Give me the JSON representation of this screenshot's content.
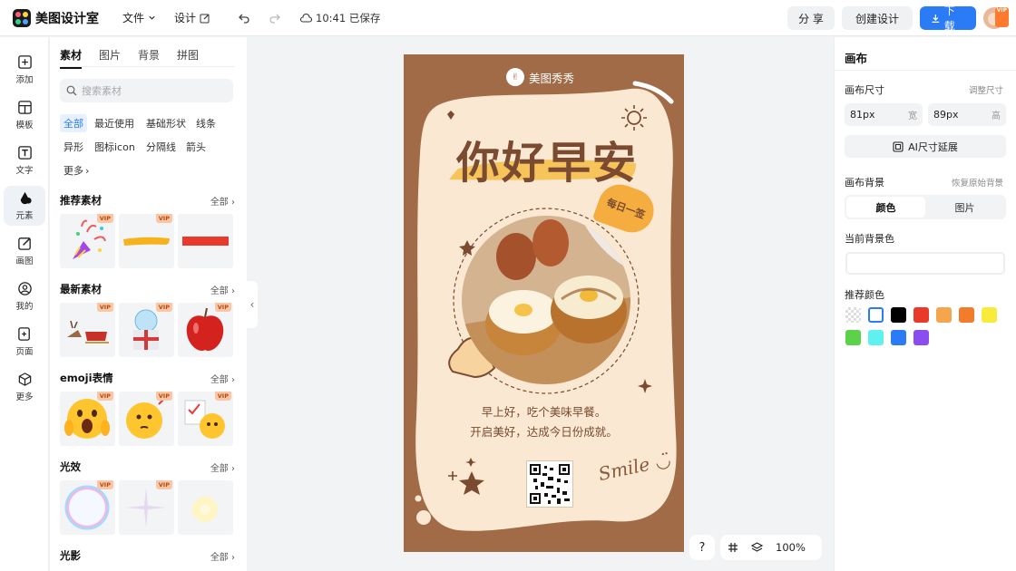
{
  "app": {
    "name": "美图设计室"
  },
  "topbar": {
    "file_menu": "文件",
    "design_menu": "设计",
    "save_status": "10:41 已保存",
    "share_label": "分 享",
    "create_label": "创建设计",
    "download_label": "下载",
    "avatar_badge": "VIP"
  },
  "nav": [
    {
      "label": "添加",
      "icon": "plus-square-icon"
    },
    {
      "label": "模板",
      "icon": "template-icon"
    },
    {
      "label": "文字",
      "icon": "text-icon"
    },
    {
      "label": "元素",
      "icon": "shapes-icon"
    },
    {
      "label": "画图",
      "icon": "draw-icon"
    },
    {
      "label": "我的",
      "icon": "user-icon"
    },
    {
      "label": "页面",
      "icon": "page-add-icon"
    },
    {
      "label": "更多",
      "icon": "cube-icon"
    }
  ],
  "panel": {
    "tabs": [
      "素材",
      "图片",
      "背景",
      "拼图"
    ],
    "search_placeholder": "搜索素材",
    "chips": [
      "全部",
      "最近使用",
      "基础形状",
      "线条",
      "异形",
      "图标icon",
      "分隔线",
      "箭头",
      "更多"
    ],
    "all_label": "全部",
    "vip_label": "VIP",
    "sections": [
      {
        "title": "推荐素材"
      },
      {
        "title": "最新素材"
      },
      {
        "title": "emoji表情"
      },
      {
        "title": "光效"
      },
      {
        "title": "光影"
      }
    ]
  },
  "poster": {
    "brand": "美图秀秀",
    "title": "你好早安",
    "stamp": "每日一签",
    "line1": "早上好，吃个美味早餐。",
    "line2": "开启美好，达成今日份成就。",
    "smile_text": "Smile",
    "colors": {
      "frame": "#a26b48",
      "cream": "#fbe8d2",
      "text": "#7a4b31",
      "accent": "#f4ad3e"
    }
  },
  "zoom": {
    "help": "?",
    "value": "100%"
  },
  "right": {
    "title": "画布",
    "size_label": "画布尺寸",
    "adjust_label": "调整尺寸",
    "width_value": "81px",
    "width_unit": "宽",
    "height_value": "89px",
    "height_unit": "高",
    "ai_extend": "AI尺寸延展",
    "bg_label": "画布背景",
    "restore_label": "恢复原始背景",
    "seg_color": "颜色",
    "seg_image": "图片",
    "current_label": "当前背景色",
    "recommend_label": "推荐颜色",
    "swatches": [
      "transparent",
      "#ffffff",
      "#000000",
      "#e8392a",
      "#f5a64c",
      "#f07c2c",
      "#f7ec3c",
      "#5bd24a",
      "#5ff0f0",
      "#2a7bf5",
      "#8a4ef0"
    ]
  }
}
